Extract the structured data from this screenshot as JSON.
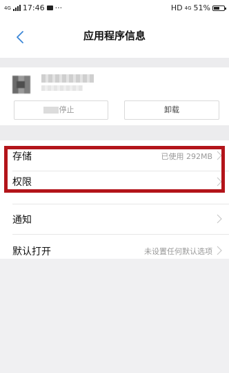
{
  "status_bar": {
    "network": "4G",
    "time": "17:46",
    "dots": "···",
    "hd": "HD",
    "network_right": "4G",
    "battery": "51%"
  },
  "header": {
    "title": "应用程序信息"
  },
  "app": {
    "stop_label": "停止",
    "uninstall_label": "卸载"
  },
  "settings": {
    "storage_label": "存储",
    "storage_value": "已使用 292MB",
    "permissions_label": "权限",
    "notifications_label": "通知",
    "default_open_label": "默认打开",
    "default_open_value": "未设置任何默认选项"
  },
  "colors": {
    "highlight": "#b3141a",
    "background": "#f0f0f2"
  }
}
